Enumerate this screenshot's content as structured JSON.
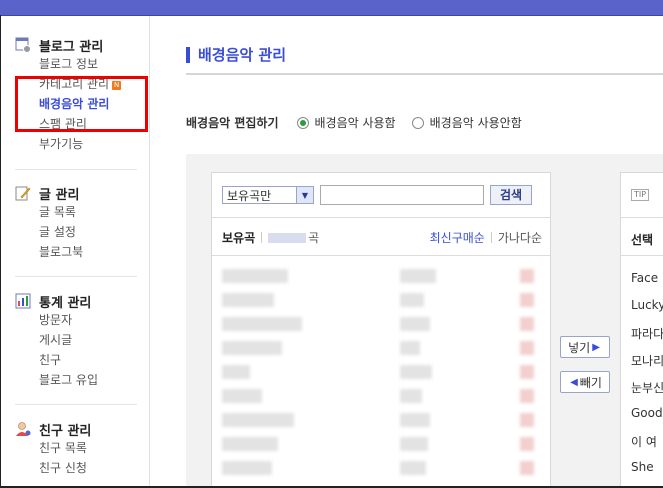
{
  "sidebar": {
    "blog": {
      "title": "블로그 관리",
      "items": [
        "블로그 정보",
        "카테고리 관리",
        "배경음악 관리",
        "스팸 관리",
        "부가기능"
      ],
      "new_badge": "N"
    },
    "posts": {
      "title": "글 관리",
      "items": [
        "글 목록",
        "글 설정",
        "블로그북"
      ]
    },
    "stats": {
      "title": "통계 관리",
      "items": [
        "방문자",
        "게시글",
        "친구",
        "블로그 유입"
      ]
    },
    "friends": {
      "title": "친구 관리",
      "items": [
        "친구 목록",
        "친구 신청"
      ]
    }
  },
  "main": {
    "title": "배경음악 관리",
    "edit_label": "배경음악 편집하기",
    "option_use": "배경음악 사용함",
    "option_nouse": "배경음악 사용안함"
  },
  "list": {
    "filter_selected": "보유곡만",
    "search_button": "검색",
    "header_label": "보유곡",
    "header_suffix": "곡",
    "sort_recent": "최신구매순",
    "sort_alpha": "가나다순"
  },
  "buttons": {
    "add": "넣기",
    "remove": "빼기"
  },
  "right": {
    "tip": "TIP",
    "header": "선택",
    "items": [
      "Face",
      "Lucky",
      "파라다",
      "모나리",
      "눈부신",
      "Good",
      "이 여",
      "She"
    ]
  },
  "colors": {
    "accent": "#3a4dd8",
    "topbar": "#5a63c9",
    "highlight_box": "#ee0000",
    "radio_on": "#2a9c3a"
  }
}
